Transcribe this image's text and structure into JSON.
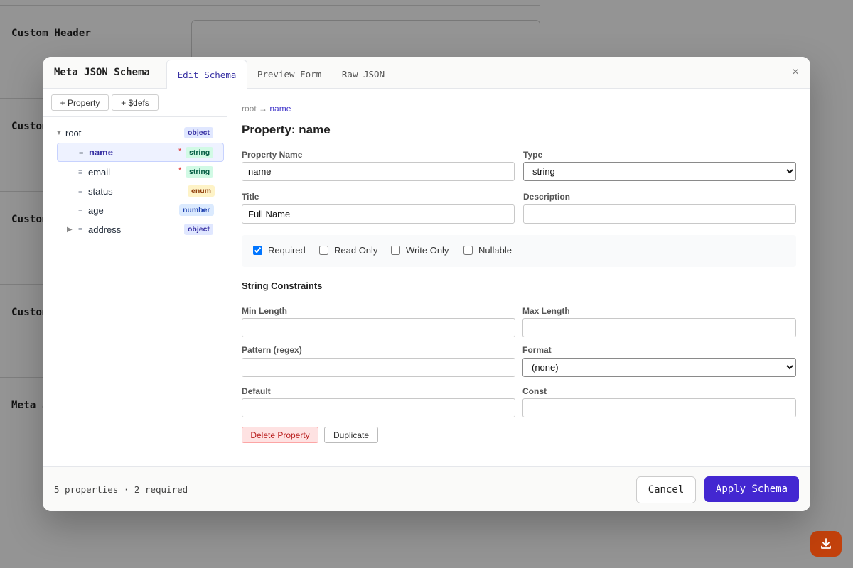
{
  "background": {
    "labels": [
      "Custom Header",
      "Custom",
      "Custom",
      "Custom",
      "Meta J"
    ]
  },
  "modal": {
    "title": "Meta JSON Schema",
    "tabs": [
      "Edit Schema",
      "Preview Form",
      "Raw JSON"
    ],
    "active_tab": "Edit Schema",
    "close_glyph": "×"
  },
  "tree": {
    "add_property": "+ Property",
    "add_defs": "+ $defs",
    "root": {
      "label": "root",
      "type": "object"
    },
    "items": [
      {
        "label": "name",
        "type": "string",
        "required": true,
        "selected": true
      },
      {
        "label": "email",
        "type": "string",
        "required": true
      },
      {
        "label": "status",
        "type": "enum"
      },
      {
        "label": "age",
        "type": "number"
      },
      {
        "label": "address",
        "type": "object",
        "expandable": true
      }
    ],
    "required_mark": "*"
  },
  "editor": {
    "breadcrumb": {
      "root": "root",
      "arrow": "→",
      "current": "name"
    },
    "heading": "Property: name",
    "property_name": {
      "label": "Property Name",
      "value": "name"
    },
    "type": {
      "label": "Type",
      "value": "string"
    },
    "title": {
      "label": "Title",
      "value": "Full Name"
    },
    "description": {
      "label": "Description",
      "value": ""
    },
    "flags": [
      {
        "label": "Required",
        "checked": true
      },
      {
        "label": "Read Only",
        "checked": false
      },
      {
        "label": "Write Only",
        "checked": false
      },
      {
        "label": "Nullable",
        "checked": false
      }
    ],
    "section": "String Constraints",
    "min_length": {
      "label": "Min Length",
      "value": ""
    },
    "max_length": {
      "label": "Max Length",
      "value": ""
    },
    "pattern": {
      "label": "Pattern (regex)",
      "value": ""
    },
    "format": {
      "label": "Format",
      "value": "(none)"
    },
    "default": {
      "label": "Default",
      "value": ""
    },
    "const": {
      "label": "Const",
      "value": ""
    },
    "delete_label": "Delete Property",
    "duplicate_label": "Duplicate"
  },
  "footer": {
    "status": "5 properties · 2 required",
    "cancel": "Cancel",
    "apply": "Apply Schema"
  },
  "colors": {
    "accent": "#4327d1",
    "fab": "#c2410c",
    "danger": "#b91c1c"
  },
  "fab": {
    "icon": "download-icon"
  }
}
